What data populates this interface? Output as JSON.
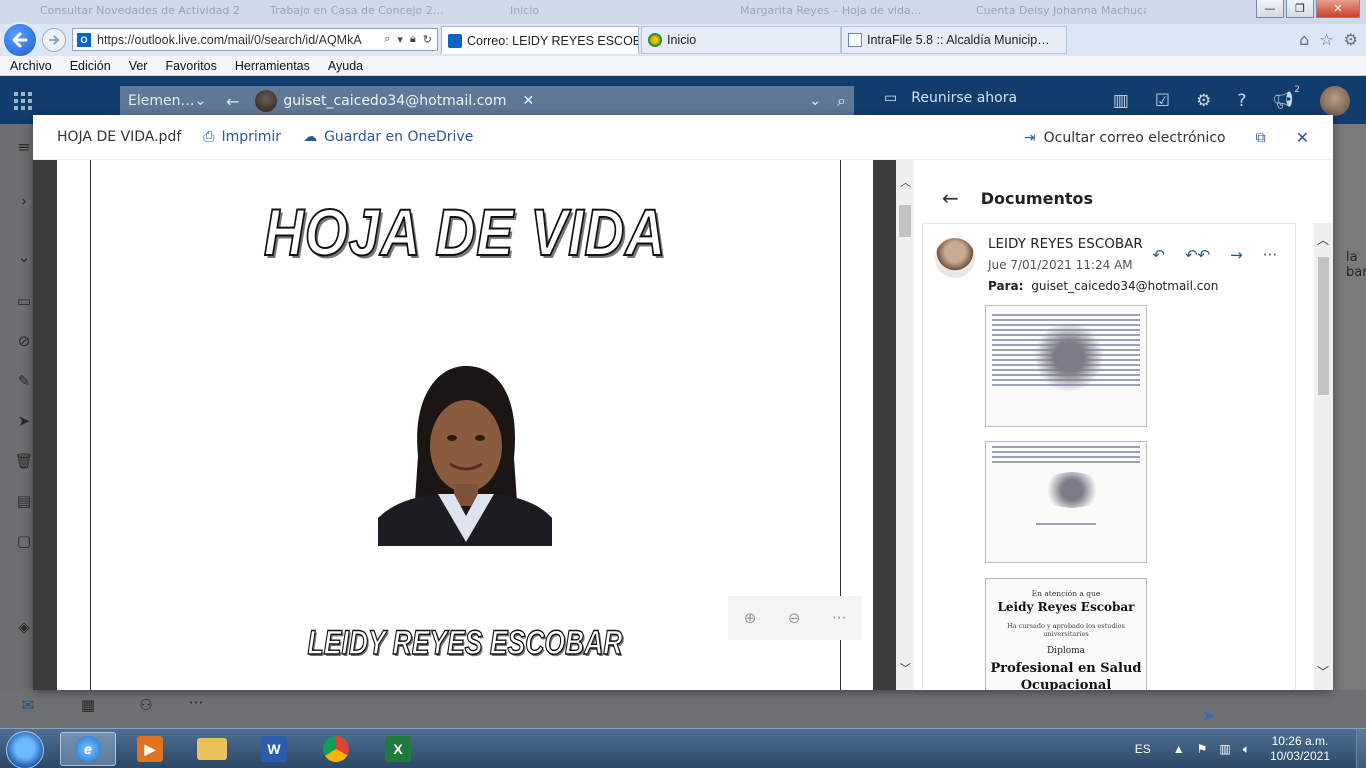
{
  "browser": {
    "background_tabs": [
      "Consultar Novedades de Actividad 27…",
      "Trabajo en Casa de Concejo 2…",
      "Inicio",
      "Margarita Reyes – Hoja de vida…",
      "Cuenta Deisy Johanna Machuca…"
    ],
    "address": "https://outlook.live.com/mail/0/search/id/AQMkA",
    "tabs": [
      {
        "label": "Correo: LEIDY REYES ESCOB…",
        "active": true
      },
      {
        "label": "Inicio",
        "active": false
      },
      {
        "label": "IntraFile 5.8 :: Alcaldía Municip…",
        "active": false
      }
    ],
    "menu": [
      "Archivo",
      "Edición",
      "Ver",
      "Favoritos",
      "Herramientas",
      "Ayuda"
    ]
  },
  "outlook": {
    "search_scope": "Elemen…",
    "search_chip": "guiset_caicedo34@hotmail.com",
    "meet_now": "Reunirse ahora",
    "notification_count": "2",
    "partial_text": "la bar"
  },
  "viewer": {
    "file_name": "HOJA DE VIDA.pdf",
    "print_label": "Imprimir",
    "save_label": "Guardar en OneDrive",
    "hide_email_label": "Ocultar correo electrónico",
    "pdf": {
      "title": "HOJA DE VIDA",
      "name": "LEIDY REYES ESCOBAR"
    }
  },
  "side": {
    "heading": "Documentos",
    "sender": "LEIDY REYES ESCOBAR",
    "date": "Jue 7/01/2021 11:24 AM",
    "to_label": "Para:",
    "to_value": "guiset_caicedo34@hotmail.con",
    "diploma": {
      "intro": "En atención a que",
      "name": "Leidy Reyes Escobar",
      "text": "Ha cursado y aprobado los estudios universitarios",
      "diploma_word": "Diploma",
      "degree": "Profesional en Salud Ocupacional"
    }
  },
  "taskbar": {
    "lang": "ES",
    "time": "10:26 a.m.",
    "date": "10/03/2021"
  }
}
